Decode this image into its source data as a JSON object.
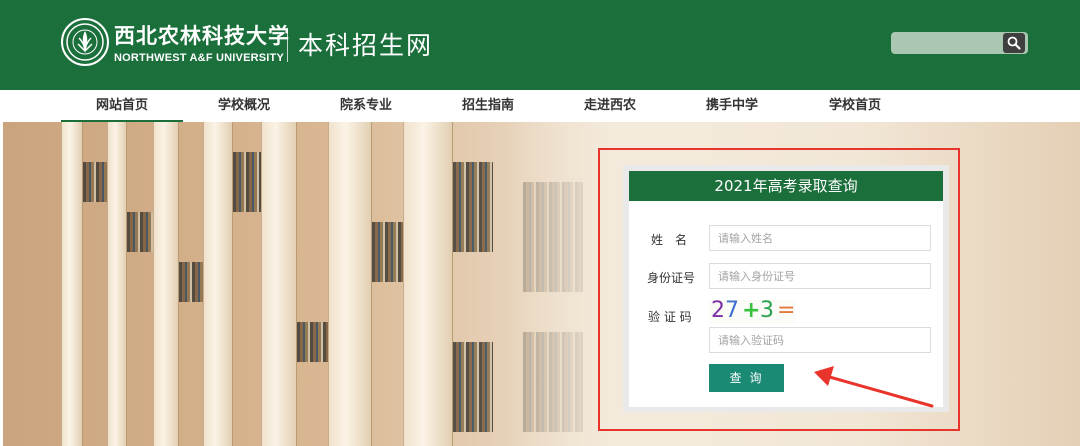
{
  "header": {
    "university_cn": "西北农林科技大学",
    "university_en": "NORTHWEST A&F UNIVERSITY",
    "site_name": "本科招生网",
    "seal_icon": "university-seal-icon",
    "search": {
      "placeholder": "",
      "icon": "search-icon"
    }
  },
  "nav": {
    "items": [
      {
        "label": "网站首页",
        "active": true
      },
      {
        "label": "学校概况",
        "active": false
      },
      {
        "label": "院系专业",
        "active": false
      },
      {
        "label": "招生指南",
        "active": false
      },
      {
        "label": "走进西农",
        "active": false
      },
      {
        "label": "携手中学",
        "active": false
      },
      {
        "label": "学校首页",
        "active": false
      }
    ]
  },
  "query_panel": {
    "title": "2021年高考录取查询",
    "name_label": "姓　名",
    "name_placeholder": "请输入姓名",
    "id_label": "身份证号",
    "id_placeholder": "请输入身份证号",
    "captcha_label": "验 证 码",
    "captcha_text": "27+3=",
    "captcha_placeholder": "请输入验证码",
    "submit_label": "查询"
  },
  "annotation": {
    "arrow_color": "#e8342b",
    "frame_color": "#e8342b"
  },
  "colors": {
    "brand_green": "#1a6f3b",
    "button_teal": "#1a8a75"
  }
}
